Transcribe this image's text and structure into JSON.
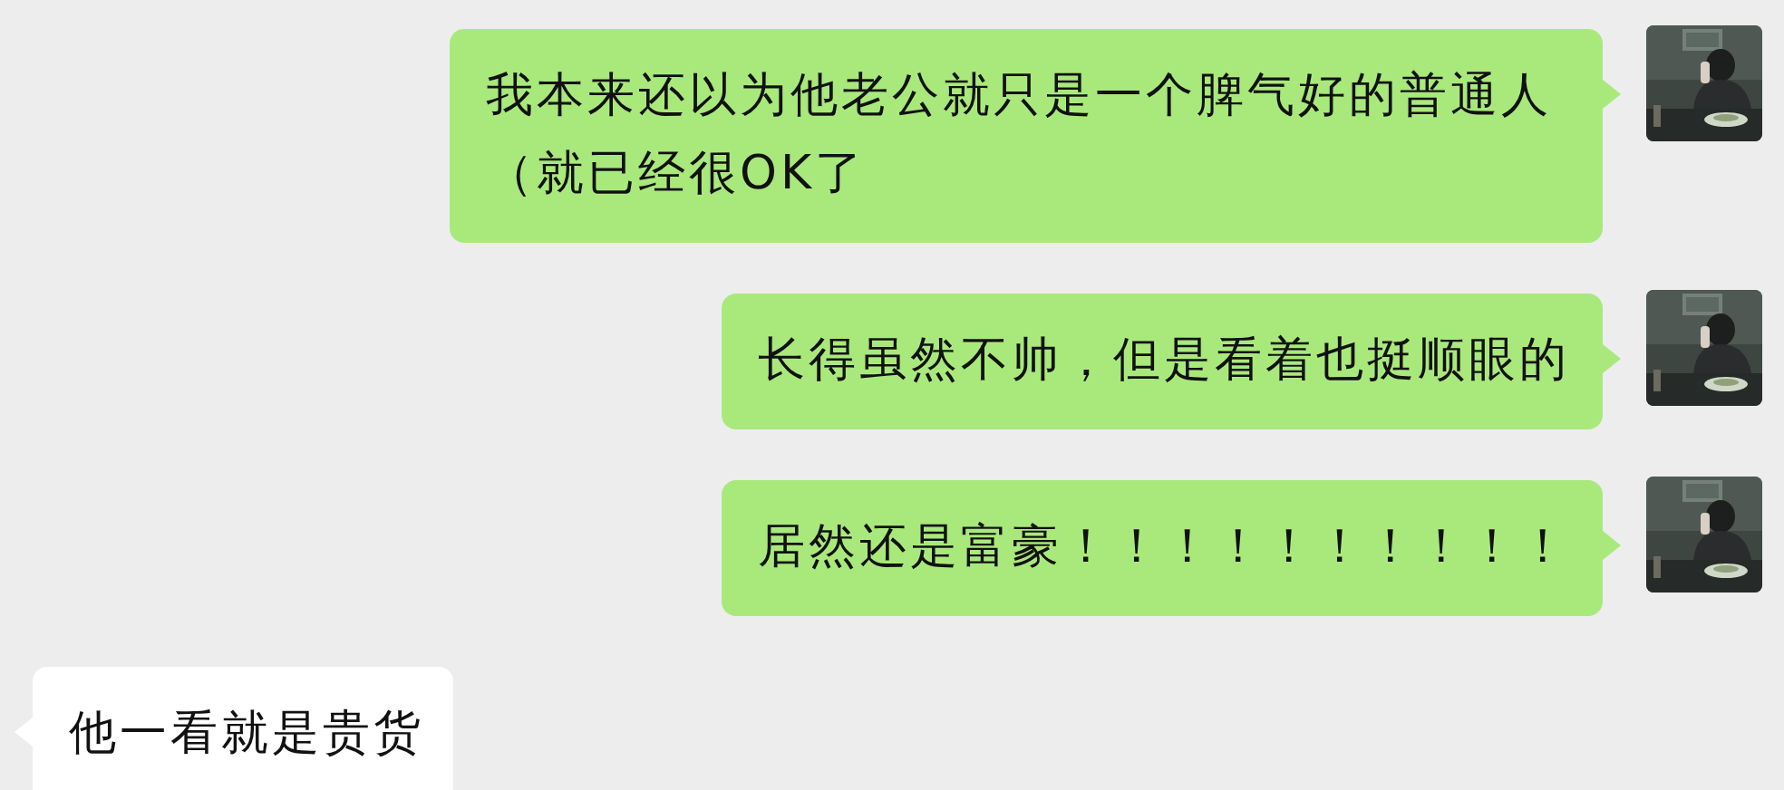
{
  "messages": [
    {
      "kind": "outgoing",
      "text": "我本来还以为他老公就只是一个脾气好的普通人（就已经很OK了"
    },
    {
      "kind": "outgoing",
      "text": "长得虽然不帅，但是看着也挺顺眼的"
    },
    {
      "kind": "outgoing",
      "text": "居然还是富豪！！！！！！！！！！"
    },
    {
      "kind": "incoming",
      "text": "他一看就是贵货"
    }
  ]
}
